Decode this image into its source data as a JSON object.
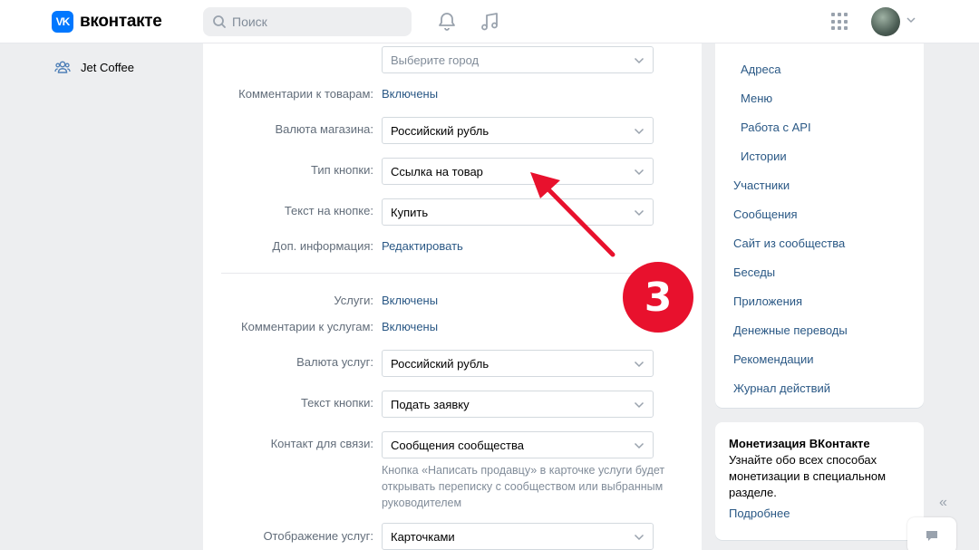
{
  "header": {
    "logo_mark": "VK",
    "logo_text": "вконтакте",
    "search_placeholder": "Поиск",
    "icons": [
      "bell-icon",
      "music-icon",
      "apps-icon"
    ]
  },
  "left_nav": {
    "items": [
      {
        "label": "Jet Coffee",
        "icon": "group-icon"
      }
    ]
  },
  "form": {
    "city_select_placeholder": "Выберите город",
    "market": {
      "comments_label": "Комментарии к товарам:",
      "comments_value": "Включены",
      "currency_label": "Валюта магазина:",
      "currency_value": "Российский рубль",
      "button_type_label": "Тип кнопки:",
      "button_type_value": "Ссылка на товар",
      "button_text_label": "Текст на кнопке:",
      "button_text_value": "Купить",
      "extra_info_label": "Доп. информация:",
      "extra_info_link": "Редактировать"
    },
    "services": {
      "services_label": "Услуги:",
      "services_value": "Включены",
      "comments_label": "Комментарии к услугам:",
      "comments_value": "Включены",
      "currency_label": "Валюта услуг:",
      "currency_value": "Российский рубль",
      "button_text_label": "Текст кнопки:",
      "button_text_value": "Подать заявку",
      "contact_label": "Контакт для связи:",
      "contact_value": "Сообщения сообщества",
      "contact_hint": "Кнопка «Написать продавцу» в карточке услуги будет открывать переписку с сообществом или выбранным руководителем",
      "display_label": "Отображение услуг:",
      "display_value": "Карточками"
    }
  },
  "right_menu": {
    "sub_items": [
      "Адреса",
      "Меню",
      "Работа с API",
      "Истории"
    ],
    "items": [
      "Участники",
      "Сообщения",
      "Сайт из сообщества",
      "Беседы",
      "Приложения",
      "Денежные переводы",
      "Рекомендации",
      "Журнал действий"
    ]
  },
  "promo": {
    "title": "Монетизация ВКонтакте",
    "text": "Узнайте обо всех способах монетизации в специальном разделе.",
    "link": "Подробнее"
  },
  "annotation": {
    "badge_number": "3",
    "color": "#e8112d"
  },
  "colors": {
    "accent": "#0077ff",
    "link": "#2a5885",
    "muted": "#626d7a",
    "background": "#edeef0"
  }
}
